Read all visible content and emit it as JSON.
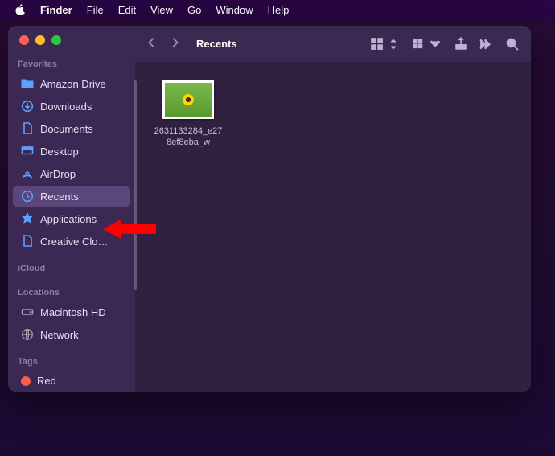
{
  "menubar": {
    "app": "Finder",
    "items": [
      "File",
      "Edit",
      "View",
      "Go",
      "Window",
      "Help"
    ]
  },
  "sidebar": {
    "favorites_header": "Favorites",
    "icloud_header": "iCloud",
    "locations_header": "Locations",
    "tags_header": "Tags",
    "favorites": [
      {
        "label": "Amazon Drive",
        "icon": "folder"
      },
      {
        "label": "Downloads",
        "icon": "download"
      },
      {
        "label": "Documents",
        "icon": "doc"
      },
      {
        "label": "Desktop",
        "icon": "desktop"
      },
      {
        "label": "AirDrop",
        "icon": "airdrop"
      },
      {
        "label": "Recents",
        "icon": "clock",
        "selected": true
      },
      {
        "label": "Applications",
        "icon": "app"
      },
      {
        "label": "Creative Clo…",
        "icon": "file"
      }
    ],
    "locations": [
      {
        "label": "Macintosh HD",
        "icon": "hd"
      },
      {
        "label": "Network",
        "icon": "globe"
      }
    ],
    "tags": [
      {
        "label": "Red",
        "color": "#ff5c48"
      }
    ]
  },
  "toolbar": {
    "title": "Recents"
  },
  "files": [
    {
      "name_line1": "2631133284_e27",
      "name_line2": "8ef8eba_w"
    }
  ],
  "annotation": {
    "arrow_target": "Applications",
    "color": "#ff0000"
  }
}
